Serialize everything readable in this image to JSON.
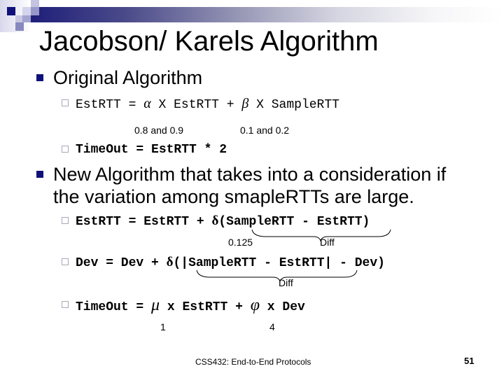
{
  "slide": {
    "title": "Jacobson/ Karels Algorithm",
    "accent_color": "#10107a",
    "sections": [
      {
        "heading": "Original Algorithm",
        "items": [
          {
            "parts": [
              "EstRTT = ",
              "α",
              " X EstRTT + ",
              "β",
              " X SampleRTT"
            ],
            "annotations": [
              "0.8 and 0.9",
              "0.1 and 0.2"
            ]
          },
          {
            "formula": "TimeOut = EstRTT * 2"
          }
        ]
      },
      {
        "heading_line1": "New Algorithm that takes into a consideration if",
        "heading_line2": "the variation among smapleRTTs are large.",
        "items": [
          {
            "parts": [
              "EstRTT = EstRTT + ",
              "δ",
              "(SampleRTT - EstRTT)"
            ],
            "annotations": [
              "0.125",
              "Diff"
            ]
          },
          {
            "parts": [
              "Dev = Dev + ",
              "δ",
              "(|SampleRTT - EstRTT| - Dev)"
            ],
            "annotations": [
              "Diff"
            ]
          },
          {
            "parts": [
              "TimeOut = ",
              "μ",
              " x EstRTT + ",
              "φ",
              " x Dev"
            ],
            "annotations": [
              "1",
              "4"
            ]
          }
        ]
      }
    ],
    "footer": "CSS432: End-to-End Protocols",
    "page_number": "51"
  }
}
